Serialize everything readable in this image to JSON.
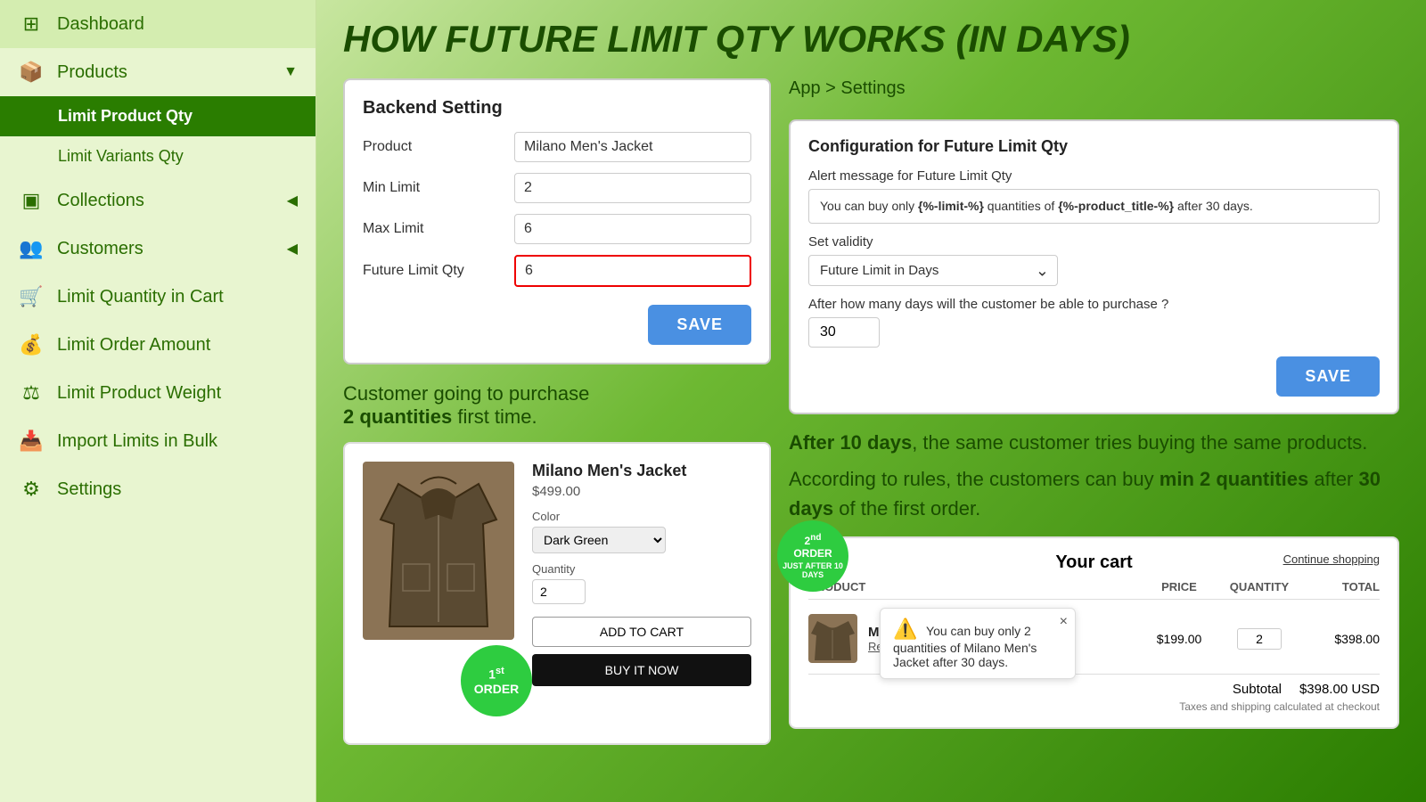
{
  "sidebar": {
    "items": [
      {
        "id": "dashboard",
        "label": "Dashboard",
        "icon": "⊞",
        "active": false,
        "hasChevron": false
      },
      {
        "id": "products",
        "label": "Products",
        "icon": "📦",
        "active": false,
        "hasChevron": true
      },
      {
        "id": "limit-product-qty",
        "label": "Limit Product Qty",
        "icon": "",
        "active": true,
        "hasChevron": false,
        "sub": true
      },
      {
        "id": "limit-variants-qty",
        "label": "Limit Variants Qty",
        "icon": "",
        "active": false,
        "hasChevron": false,
        "sub": true
      },
      {
        "id": "collections",
        "label": "Collections",
        "icon": "⊟",
        "active": false,
        "hasChevron": true
      },
      {
        "id": "customers",
        "label": "Customers",
        "icon": "👥",
        "active": false,
        "hasChevron": true
      },
      {
        "id": "limit-quantity-cart",
        "label": "Limit Quantity in Cart",
        "icon": "🛒",
        "active": false,
        "hasChevron": false
      },
      {
        "id": "limit-order-amount",
        "label": "Limit Order Amount",
        "icon": "💰",
        "active": false,
        "hasChevron": false
      },
      {
        "id": "limit-product-weight",
        "label": "Limit Product Weight",
        "icon": "⚖",
        "active": false,
        "hasChevron": false
      },
      {
        "id": "import-limits-bulk",
        "label": "Import Limits in Bulk",
        "icon": "📥",
        "active": false,
        "hasChevron": false
      },
      {
        "id": "settings",
        "label": "Settings",
        "icon": "⚙",
        "active": false,
        "hasChevron": false
      }
    ]
  },
  "main": {
    "page_title": "HOW FUTURE LIMIT QTY WORKS (IN DAYS)",
    "breadcrumb": "App > Settings",
    "backend_setting": {
      "title": "Backend Setting",
      "fields": [
        {
          "label": "Product",
          "value": "Milano Men's Jacket",
          "highlighted": false
        },
        {
          "label": "Min Limit",
          "value": "2",
          "highlighted": false
        },
        {
          "label": "Max Limit",
          "value": "6",
          "highlighted": false
        },
        {
          "label": "Future Limit Qty",
          "value": "6",
          "highlighted": true
        }
      ],
      "save_btn": "SAVE"
    },
    "config": {
      "title": "Configuration for Future Limit Qty",
      "alert_label": "Alert message for Future Limit Qty",
      "alert_msg_prefix": "You can buy only ",
      "alert_msg_code1": "{%-limit-%}",
      "alert_msg_mid": " quantities of ",
      "alert_msg_code2": "{%-product_title-%}",
      "alert_msg_suffix": " after 30 days.",
      "validity_label": "Set validity",
      "validity_option": "Future Limit in Days",
      "days_label": "After how many days will the customer be able to purchase ?",
      "days_value": "30",
      "save_btn": "SAVE"
    },
    "customer_text": {
      "line1": "Customer going to purchase",
      "line2_bold": "2 quantities",
      "line2_rest": " first time."
    },
    "product_card": {
      "name": "Milano Men's Jacket",
      "price": "$499.00",
      "color_label": "Color",
      "color_value": "Dark Green",
      "qty_label": "Quantity",
      "qty_value": "2",
      "add_to_cart": "ADD TO CART",
      "buy_now": "BUY IT NOW",
      "order_badge": {
        "sup": "st",
        "num": "1",
        "label": "ORDER"
      }
    },
    "after_days_text": {
      "bold1": "After 10 days",
      "rest1": ", the same customer tries buying the same products.",
      "line2_prefix": "According to rules, the customers can buy ",
      "bold2": "min 2 quantities",
      "line2_mid": " after ",
      "bold3": "30 days",
      "line2_suffix": " of the first order."
    },
    "cart": {
      "title": "Your cart",
      "continue_shopping": "Continue shopping",
      "headers": [
        "PRODUCT",
        "PRICE",
        "QUANTITY",
        "TOTAL"
      ],
      "order_badge_2nd": {
        "sup": "nd",
        "num": "2",
        "label": "ORDER",
        "sub": "JUST AFTER 10 DAYS"
      },
      "row": {
        "product_name": "Milano Men's Jacket",
        "remove": "Remove",
        "price": "$199.00",
        "qty": "2",
        "total": "$398.00"
      },
      "subtotal_label": "Subtotal",
      "subtotal_value": "$398.00 USD",
      "taxes_text": "Taxes and shipping calculated at checkout",
      "tooltip": {
        "warning_icon": "⚠",
        "text": "You can buy only 2 quantities of Milano Men's Jacket after 30 days.",
        "close": "×"
      }
    }
  }
}
